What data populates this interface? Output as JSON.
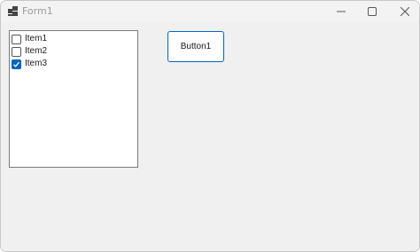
{
  "window": {
    "title": "Form1",
    "icons": {
      "app": "form-icon",
      "minimize": "minimize-icon",
      "maximize": "maximize-icon",
      "close": "close-icon"
    }
  },
  "checked_list": {
    "items": [
      {
        "label": "Item1",
        "checked": false
      },
      {
        "label": "Item2",
        "checked": false
      },
      {
        "label": "Item3",
        "checked": true
      }
    ]
  },
  "button1": {
    "label": "Button1"
  },
  "colors": {
    "accent": "#0067c0",
    "window_bg": "#f0f0f0",
    "title_text": "#9a9a9a"
  }
}
